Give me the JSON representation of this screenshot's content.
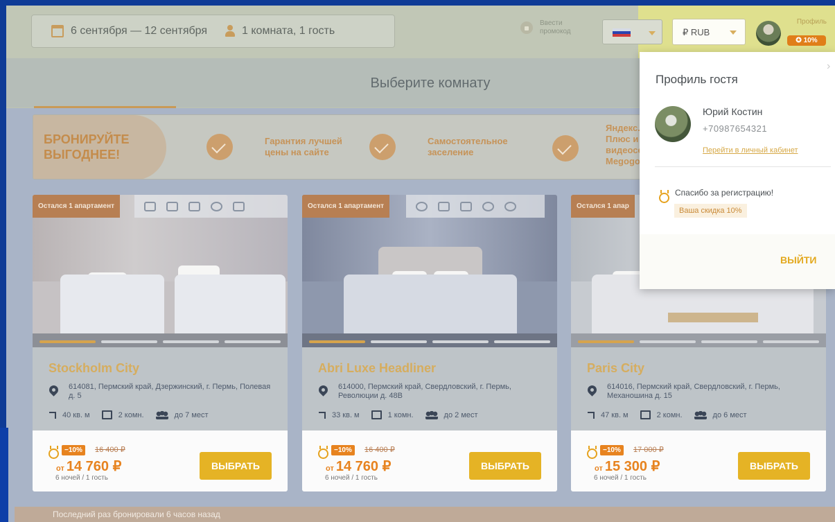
{
  "header": {
    "dates": "6 сентября — 12 сентября",
    "guests": "1 комната, 1 гость",
    "promo_line1": "Ввести",
    "promo_line2": "промокод",
    "currency": "₽ RUB",
    "profile_label": "Профиль",
    "profile_discount": "10%"
  },
  "page": {
    "title": "Выберите комнату"
  },
  "benefits": {
    "headline_line1": "БРОНИРУЙТЕ",
    "headline_line2": "ВЫГОДНЕЕ!",
    "items": [
      {
        "line1": "Гарантия лучшей",
        "line2": "цены на сайте"
      },
      {
        "line1": "Самостоятельное",
        "line2": "заселение"
      },
      {
        "line1": "Яндекс.Ста",
        "line2": "Плюс и",
        "line3": "видеосерв",
        "line4": "Megogo"
      }
    ]
  },
  "rooms": [
    {
      "tag": "Остался 1 апартамент",
      "name": "Stockholm City",
      "address": "614081, Пермский край, Дзержинский, г. Пермь, Полевая д. 5",
      "area": "40 кв. м",
      "rooms": "2 комн.",
      "capacity": "до 7 мест",
      "discount": "−10%",
      "old_price": "16 400 ₽",
      "price_prefix": "от",
      "price": "14 760 ₽",
      "nights": "6 ночей / 1 гость",
      "button": "ВЫБРАТЬ"
    },
    {
      "tag": "Остался 1 апартамент",
      "name": "Abri Luxe Headliner",
      "address": "614000, Пермский край, Свердловский, г. Пермь, Революции д. 48В",
      "area": "33 кв. м",
      "rooms": "1 комн.",
      "capacity": "до 2 мест",
      "discount": "−10%",
      "old_price": "16 400 ₽",
      "price_prefix": "от",
      "price": "14 760 ₽",
      "nights": "6 ночей / 1 гость",
      "button": "ВЫБРАТЬ"
    },
    {
      "tag": "Остался 1 апар",
      "name": "Paris City",
      "address": "614016, Пермский край, Свердловский, г. Пермь, Механошина д. 15",
      "area": "47 кв. м",
      "rooms": "2 комн.",
      "capacity": "до 6 мест",
      "discount": "−10%",
      "old_price": "17 000 ₽",
      "price_prefix": "от",
      "price": "15 300 ₽",
      "nights": "6 ночей / 1 гость",
      "button": "ВЫБРАТЬ"
    }
  ],
  "footer_note": "Последний раз бронировали 6 часов назад",
  "profile_popover": {
    "title": "Профиль гостя",
    "name": "Юрий Костин",
    "phone": "+70987654321",
    "cabinet_link": "Перейти в личный кабинет",
    "thanks": "Спасибо за регистрацию!",
    "discount_text": "Ваша скидка 10%",
    "logout": "ВЫЙТИ"
  },
  "colors": {
    "accent": "#e5b325",
    "discount": "#e7831f",
    "brand_text": "#d6ad5e"
  }
}
